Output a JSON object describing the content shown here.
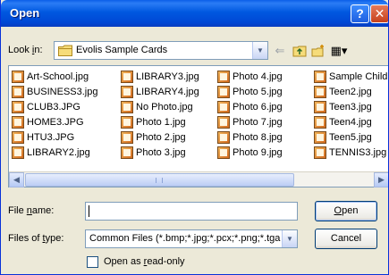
{
  "window": {
    "title": "Open",
    "help_glyph": "?",
    "close_glyph": "✕"
  },
  "lookin": {
    "label_prefix": "Look ",
    "label_accel": "i",
    "label_suffix": "n:",
    "value": "Evolis Sample Cards",
    "arrow": "▼"
  },
  "toolbar": {
    "back_glyph": "⇐",
    "up_glyph": "⬒",
    "newfolder_glyph": "✱",
    "views_glyph": "▦▾"
  },
  "files": {
    "col1": [
      "Art-School.jpg",
      "BUSINESS3.jpg",
      "CLUB3.JPG",
      "HOME3.JPG",
      "HTU3.JPG",
      "LIBRARY2.jpg"
    ],
    "col2": [
      "LIBRARY3.jpg",
      "LIBRARY4.jpg",
      "No Photo.jpg",
      "Photo 1.jpg",
      "Photo 2.jpg",
      "Photo 3.jpg"
    ],
    "col3": [
      "Photo 4.jpg",
      "Photo 5.jpg",
      "Photo 6.jpg",
      "Photo 7.jpg",
      "Photo 8.jpg",
      "Photo 9.jpg"
    ],
    "col4": [
      "Sample Child.j",
      "Teen2.jpg",
      "Teen3.jpg",
      "Teen4.jpg",
      "Teen5.jpg",
      "TENNIS3.jpg"
    ]
  },
  "scrollbar": {
    "left_glyph": "◀",
    "right_glyph": "▶"
  },
  "filename": {
    "label_prefix": "File ",
    "label_accel": "n",
    "label_suffix": "ame:",
    "value": ""
  },
  "filetype": {
    "label_prefix": "Files of ",
    "label_accel": "t",
    "label_suffix": "ype:",
    "value": "Common Files (*.bmp;*.jpg;*.pcx;*.png;*.tga;*",
    "arrow": "▼"
  },
  "buttons": {
    "open_accel": "O",
    "open_rest": "pen",
    "cancel": "Cancel"
  },
  "readonly": {
    "label_prefix": "Open as ",
    "label_accel": "r",
    "label_suffix": "ead-only"
  },
  "colors": {
    "titlebar": "#0058e0",
    "dialog_bg": "#ece9d8",
    "border": "#7f9db9"
  }
}
